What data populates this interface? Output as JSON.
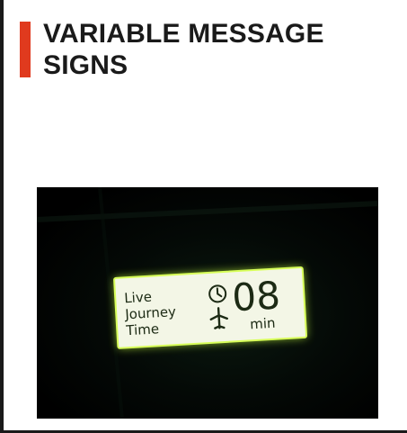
{
  "heading": {
    "title": "VARIABLE MESSAGE SIGNS",
    "accent_color": "#e03a1e"
  },
  "photo": {
    "sign": {
      "label_line1": "Live",
      "label_line2": "Journey",
      "label_line3": "Time",
      "value": "08",
      "unit": "min",
      "clock_icon": "clock-icon",
      "plane_icon": "airplane-icon",
      "panel_color": "#f3f6e6",
      "glow_color": "#c8ff3a"
    }
  }
}
